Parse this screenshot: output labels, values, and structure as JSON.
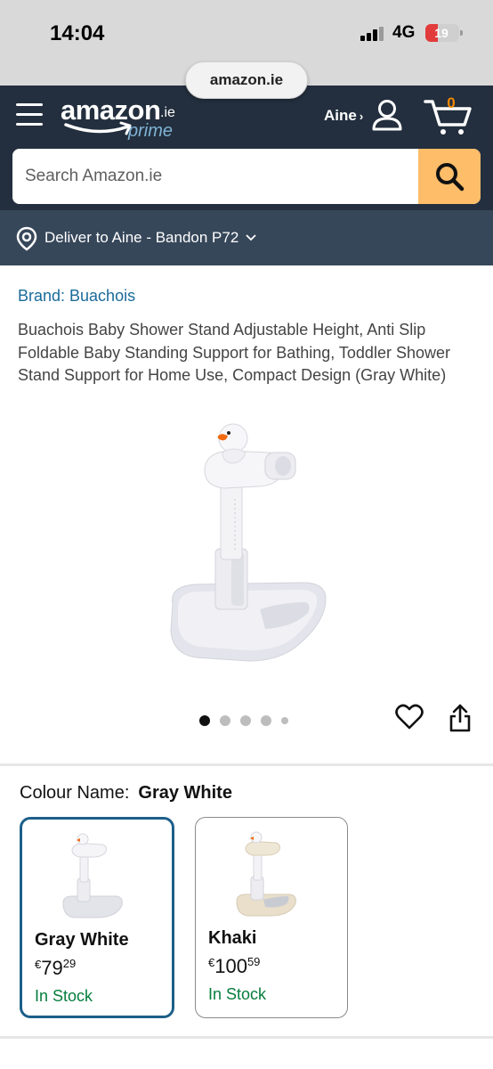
{
  "status_bar": {
    "time": "14:04",
    "network": "4G",
    "battery": "19"
  },
  "browser": {
    "url": "amazon.ie"
  },
  "header": {
    "logo_word": "amazon",
    "logo_tld": ".ie",
    "logo_sub": "prime",
    "account_name": "Aine",
    "cart_count": "0",
    "search_placeholder": "Search Amazon.ie"
  },
  "delivery": {
    "text": "Deliver to Aine - Bandon P72"
  },
  "product": {
    "brand": "Brand: Buachois",
    "title": "Buachois Baby Shower Stand Adjustable Height, Anti Slip Foldable Baby Standing Support for Bathing, Toddler Shower Stand Support for Home Use, Compact Design (Gray White)",
    "image_count": 5,
    "active_image": 1
  },
  "colour": {
    "label": "Colour Name:",
    "selected": "Gray White",
    "options": [
      {
        "name": "Gray White",
        "currency": "€",
        "price_whole": "79",
        "price_fraction": "29",
        "stock": "In Stock",
        "base_color": "#dfe0e6"
      },
      {
        "name": "Khaki",
        "currency": "€",
        "price_whole": "100",
        "price_fraction": "59",
        "stock": "In Stock",
        "base_color": "#e8ddc8"
      }
    ]
  },
  "colors": {
    "header_bg": "#232f3e",
    "delivery_bg": "#37475a",
    "search_button": "#febd69",
    "link": "#1a6b9a",
    "in_stock": "#067d3c",
    "selected_border": "#1d5f8a"
  }
}
